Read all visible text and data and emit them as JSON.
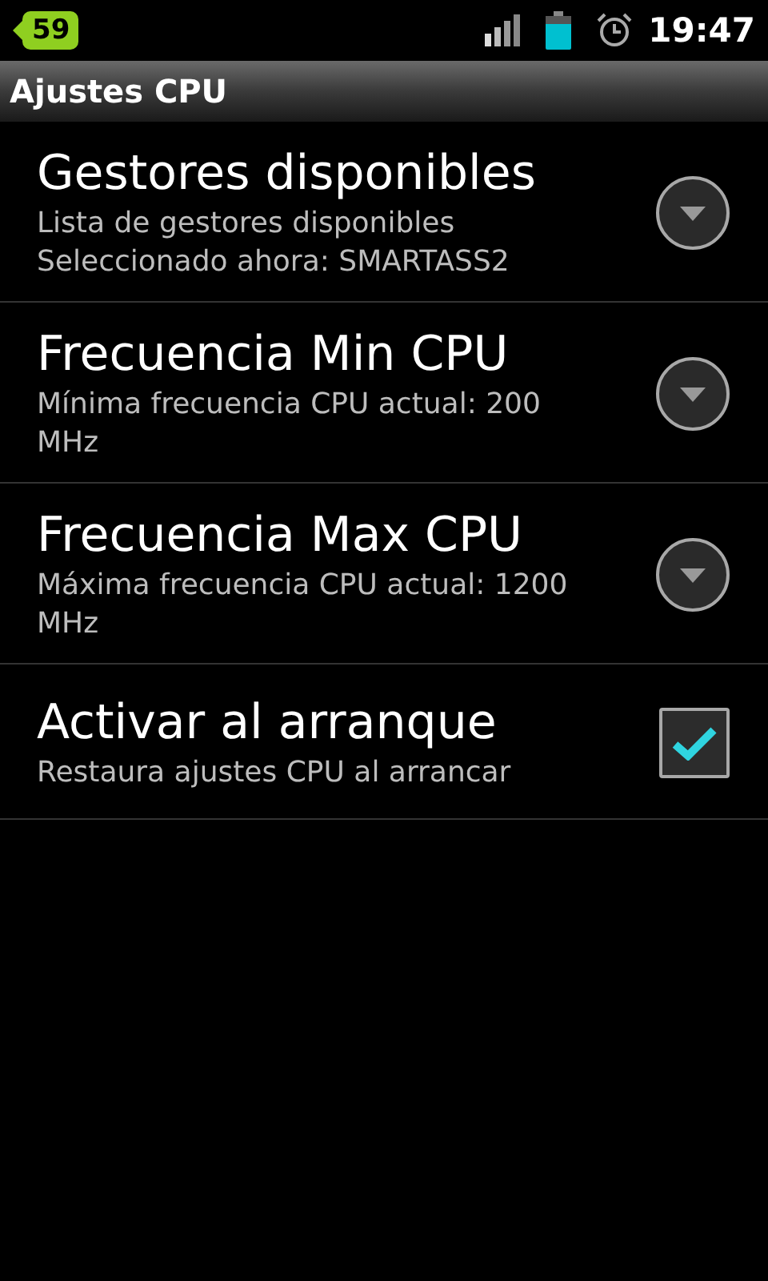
{
  "status_bar": {
    "notification_count": "59",
    "time": "19:47"
  },
  "title": "Ajustes CPU",
  "settings": [
    {
      "kind": "list",
      "title": "Gestores disponibles",
      "summary": [
        "Lista de gestores disponibles",
        "Seleccionado ahora: SMARTASS2"
      ]
    },
    {
      "kind": "list",
      "title": "Frecuencia Min CPU",
      "summary": [
        "Mínima frecuencia CPU actual: 200 MHz"
      ]
    },
    {
      "kind": "list",
      "title": "Frecuencia Max CPU",
      "summary": [
        "Máxima frecuencia CPU actual: 1200 MHz"
      ]
    },
    {
      "kind": "checkbox",
      "title": "Activar al arranque",
      "summary": [
        "Restaura ajustes CPU al arrancar"
      ],
      "checked": true
    }
  ]
}
